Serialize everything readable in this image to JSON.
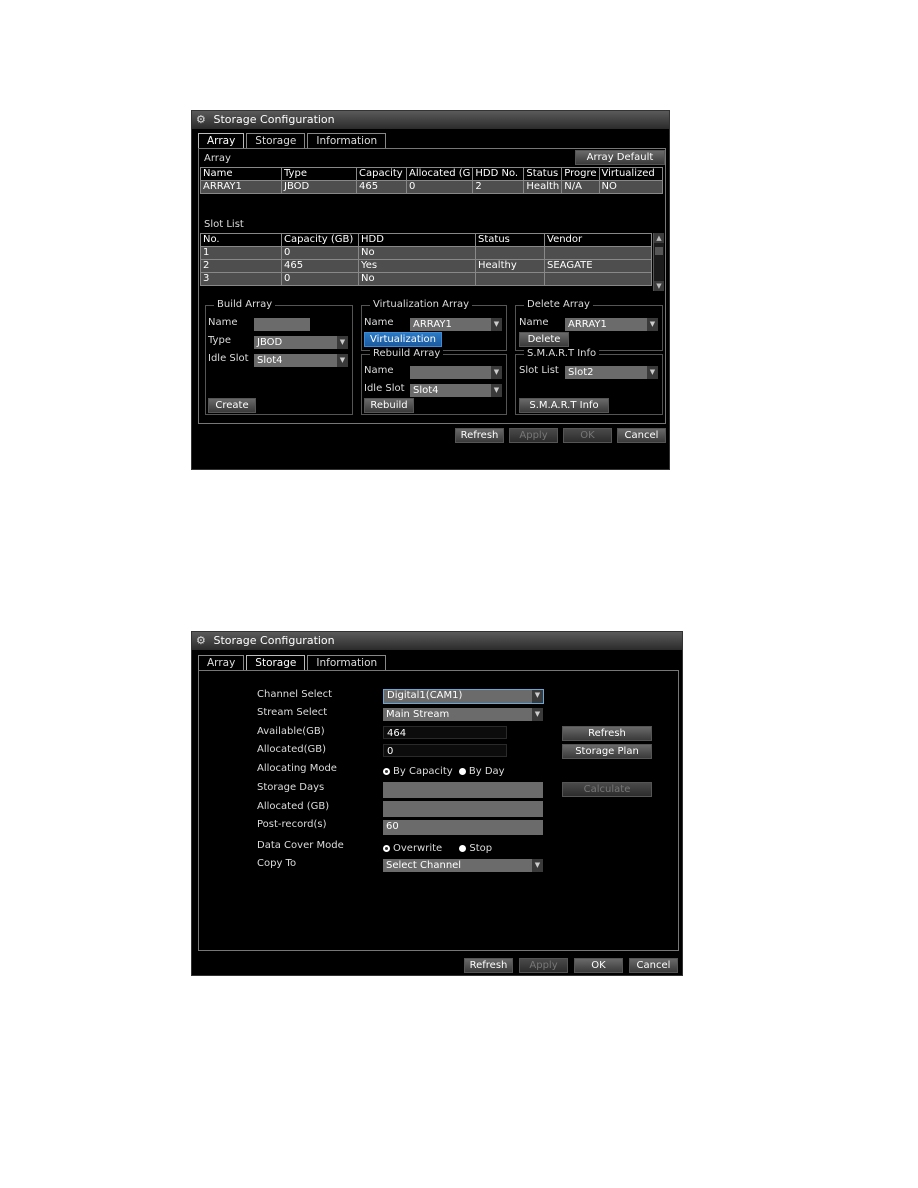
{
  "screen1": {
    "title": "Storage Configuration",
    "tabs": [
      {
        "label": "Array",
        "active": true
      },
      {
        "label": "Storage",
        "active": false
      },
      {
        "label": "Information",
        "active": false
      }
    ],
    "array_section_label": "Array",
    "array_default_button": "Array Default",
    "array_table": {
      "headers": [
        "Name",
        "Type",
        "Capacity",
        "Allocated (G",
        "HDD No.",
        "Status",
        "Progre",
        "Virtualized"
      ],
      "rows": [
        [
          "ARRAY1",
          "JBOD",
          "465",
          "0",
          "2",
          "Health",
          "N/A",
          "NO"
        ]
      ]
    },
    "slot_list_label": "Slot List",
    "slot_table": {
      "headers": [
        "No.",
        "Capacity (GB)",
        "HDD",
        "Status",
        "Vendor"
      ],
      "rows": [
        [
          "1",
          "0",
          "No",
          "",
          ""
        ],
        [
          "2",
          "465",
          "Yes",
          "Healthy",
          "SEAGATE"
        ],
        [
          "3",
          "0",
          "No",
          "",
          ""
        ]
      ]
    },
    "build_array": {
      "title": "Build Array",
      "name_label": "Name",
      "name_value": "",
      "type_label": "Type",
      "type_value": "JBOD",
      "idle_slot_label": "Idle Slot",
      "idle_slot_value": "Slot4",
      "create_button": "Create"
    },
    "virtualization_array": {
      "title": "Virtualization Array",
      "name_label": "Name",
      "name_value": "ARRAY1",
      "button": "Virtualization"
    },
    "rebuild_array": {
      "title": "Rebuild Array",
      "name_label": "Name",
      "name_value": "",
      "idle_slot_label": "Idle Slot",
      "idle_slot_value": "Slot4",
      "button": "Rebuild"
    },
    "delete_array": {
      "title": "Delete Array",
      "name_label": "Name",
      "name_value": "ARRAY1",
      "button": "Delete"
    },
    "smart_info": {
      "title": "S.M.A.R.T Info",
      "slot_list_label": "Slot List",
      "slot_list_value": "Slot2",
      "button": "S.M.A.R.T Info"
    },
    "footer": {
      "refresh": "Refresh",
      "apply": "Apply",
      "ok": "OK",
      "cancel": "Cancel"
    }
  },
  "screen2": {
    "title": "Storage Configuration",
    "tabs": [
      {
        "label": "Array",
        "active": false
      },
      {
        "label": "Storage",
        "active": true
      },
      {
        "label": "Information",
        "active": false
      }
    ],
    "form": {
      "channel_select_label": "Channel Select",
      "channel_select_value": "Digital1(CAM1)",
      "stream_select_label": "Stream Select",
      "stream_select_value": "Main Stream",
      "available_label": "Available(GB)",
      "available_value": "464",
      "allocated_label": "Allocated(GB)",
      "allocated_value": "0",
      "allocating_mode_label": "Allocating Mode",
      "allocating_mode_options": [
        "By Capacity",
        "By Day"
      ],
      "allocating_mode_selected": "By Capacity",
      "storage_days_label": "Storage Days",
      "storage_days_value": "",
      "allocated2_label": "Allocated (GB)",
      "allocated2_value": "",
      "post_record_label": "Post-record(s)",
      "post_record_value": "60",
      "data_cover_mode_label": "Data Cover Mode",
      "data_cover_mode_options": [
        "Overwrite",
        "Stop"
      ],
      "data_cover_mode_selected": "Overwrite",
      "copy_to_label": "Copy To",
      "copy_to_value": "Select Channel"
    },
    "side_buttons": {
      "refresh": "Refresh",
      "storage_plan": "Storage Plan",
      "calculate": "Calculate"
    },
    "footer": {
      "refresh": "Refresh",
      "apply": "Apply",
      "ok": "OK",
      "cancel": "Cancel"
    }
  }
}
